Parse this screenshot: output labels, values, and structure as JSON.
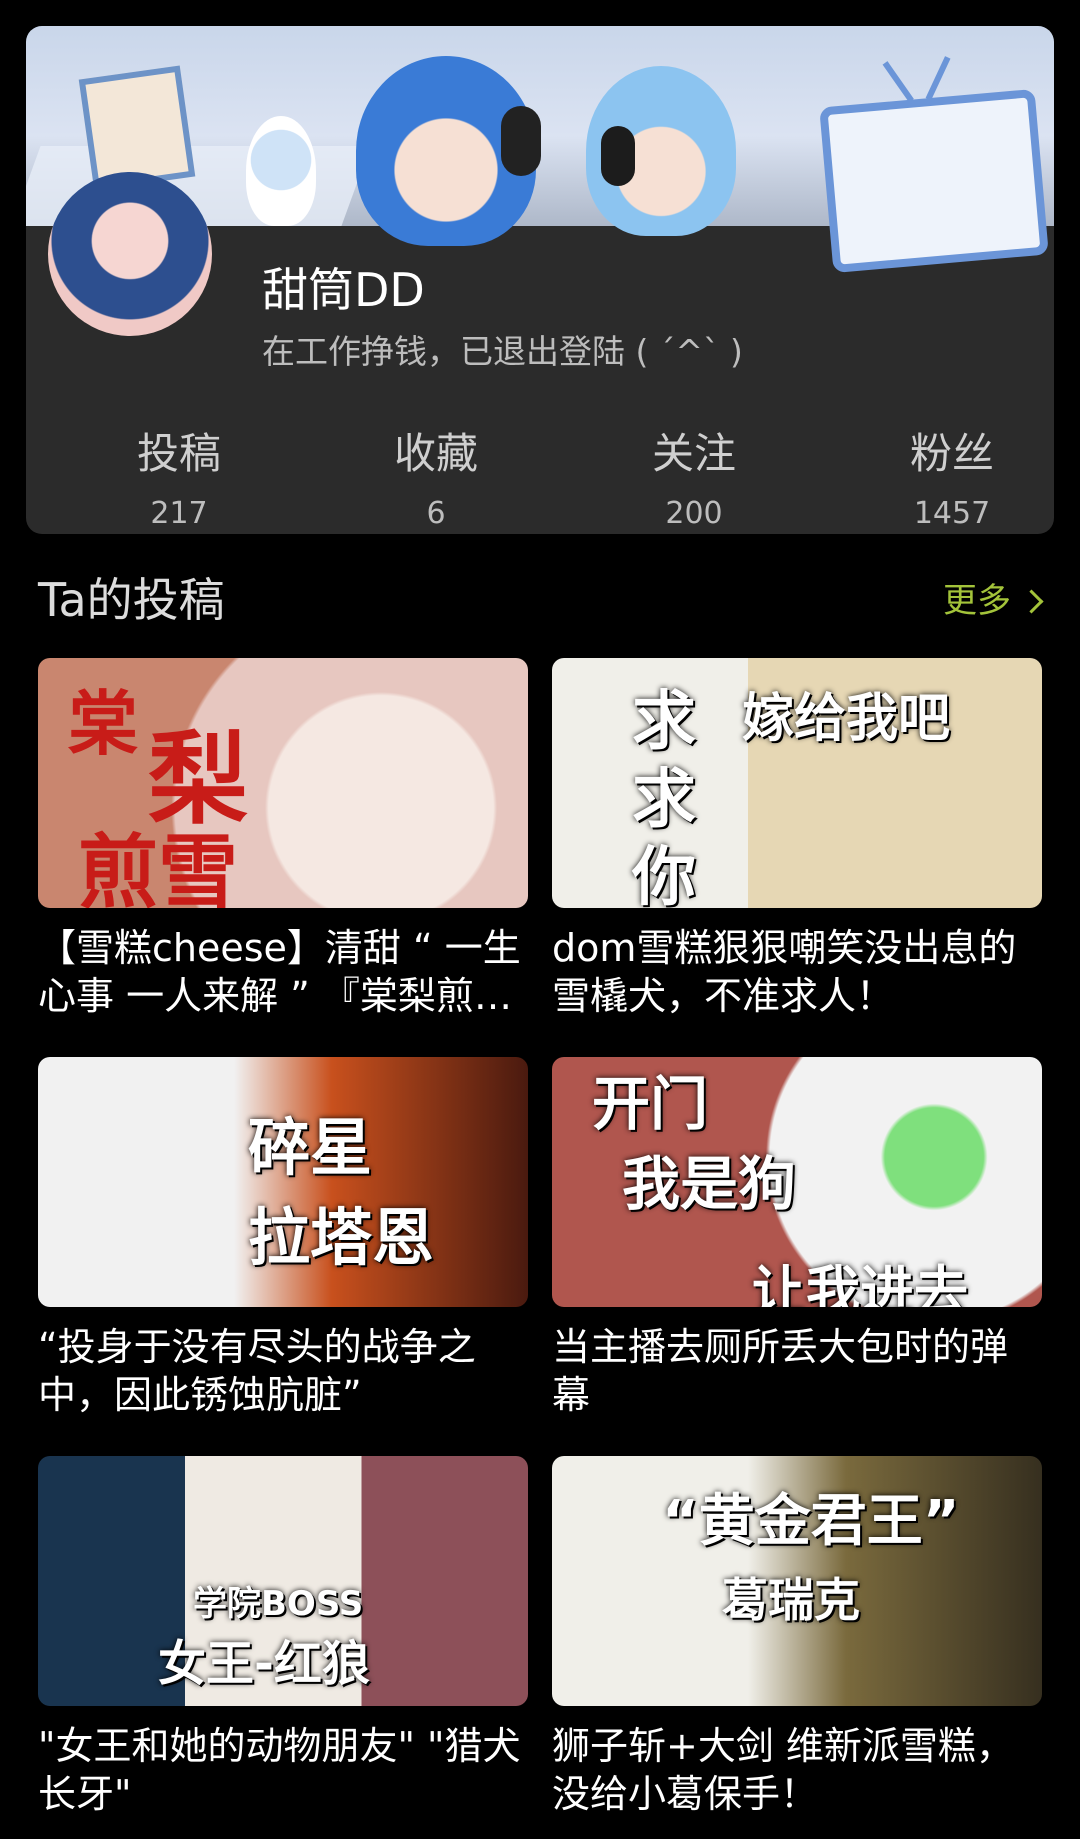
{
  "profile": {
    "username": "甜筒DD",
    "signature": "在工作挣钱，已退出登陆 ( ´^` )",
    "stats": [
      {
        "label": "投稿",
        "value": "217"
      },
      {
        "label": "收藏",
        "value": "6"
      },
      {
        "label": "关注",
        "value": "200"
      },
      {
        "label": "粉丝",
        "value": "1457"
      }
    ]
  },
  "section": {
    "title": "Ta的投稿",
    "more_label": "更多"
  },
  "videos": [
    {
      "title": "【雪糕cheese】清甜 “ 一生心事 一人来解 ” 『棠梨煎雪』",
      "thumb_text": [
        "棠",
        "梨",
        "煎雪"
      ]
    },
    {
      "title": "dom雪糕狠狠嘲笑没出息的雪橇犬，不准求人！",
      "thumb_text": [
        "求",
        "求",
        "你",
        "嫁给我吧"
      ]
    },
    {
      "title": "“投身于没有尽头的战争之中，因此锈蚀肮脏”",
      "thumb_text": [
        "碎星",
        "拉塔恩"
      ]
    },
    {
      "title": "当主播去厕所丢大包时的弹幕",
      "thumb_text": [
        "开门",
        "我是狗",
        "让我进去"
      ]
    },
    {
      "title": "\"女王和她的动物朋友\" \"猎犬长牙\"",
      "thumb_text": [
        "学院BOSS",
        "女王-红狼"
      ]
    },
    {
      "title": "狮子斩+大剑  维新派雪糕，没给小葛保手！",
      "thumb_text": [
        "“黄金君王”",
        "葛瑞克"
      ]
    }
  ],
  "colors": {
    "accent": "#a3c33a",
    "card_bg": "#2b2b2b",
    "page_bg": "#000000"
  }
}
